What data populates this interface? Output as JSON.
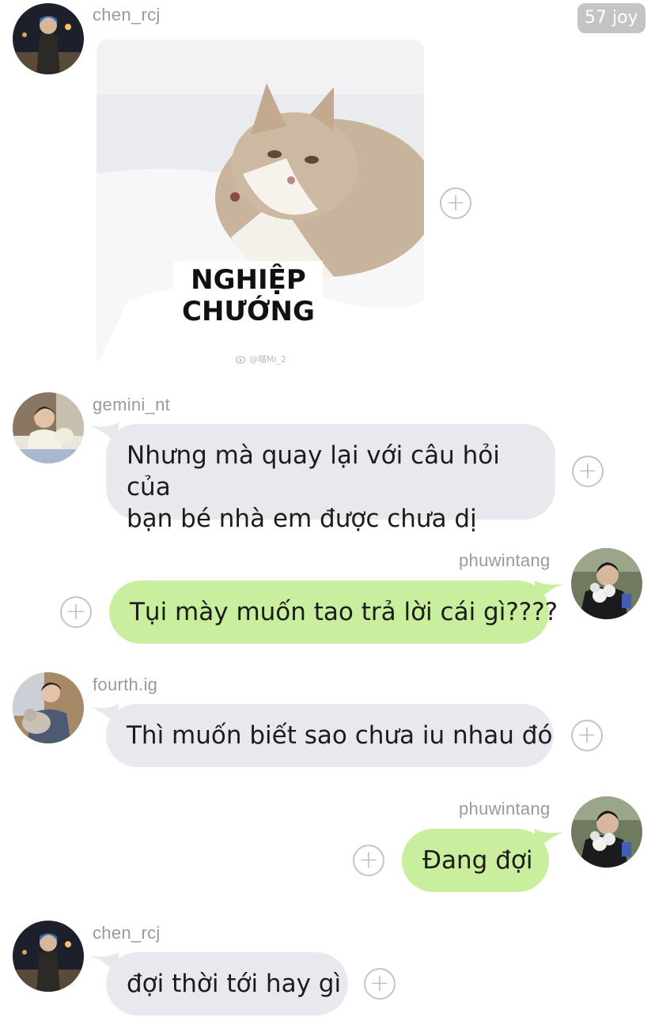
{
  "badge": "57 joy",
  "messages": [
    {
      "user": "chen_rcj",
      "kind": "sticker",
      "caption_line1": "NGHIỆP",
      "caption_line2": "CHƯỚNG",
      "watermark": "@喵Mi_2"
    },
    {
      "user": "gemini_nt",
      "kind": "text",
      "line1": "Nhưng mà quay lại với câu hỏi của",
      "line2": "bạn bé nhà em được chưa dị"
    },
    {
      "user": "phuwintang",
      "kind": "text",
      "text": "Tụi mày muốn tao trả lời cái gì????"
    },
    {
      "user": "fourth.ig",
      "kind": "text",
      "text": "Thì muốn biết sao chưa iu nhau đó"
    },
    {
      "user": "phuwintang",
      "kind": "text",
      "text": "Đang đợi"
    },
    {
      "user": "chen_rcj",
      "kind": "text",
      "text": "đợi thời tới hay gì"
    }
  ],
  "plus_glyph": "+",
  "colors": {
    "incoming_bubble": "#e7e9ee",
    "outgoing_bubble": "#c8ee9e",
    "username": "#9a9a9a",
    "badge": "#c4c4c4"
  },
  "icons": [
    "avatar",
    "add-reaction-icon",
    "weibo-icon"
  ]
}
